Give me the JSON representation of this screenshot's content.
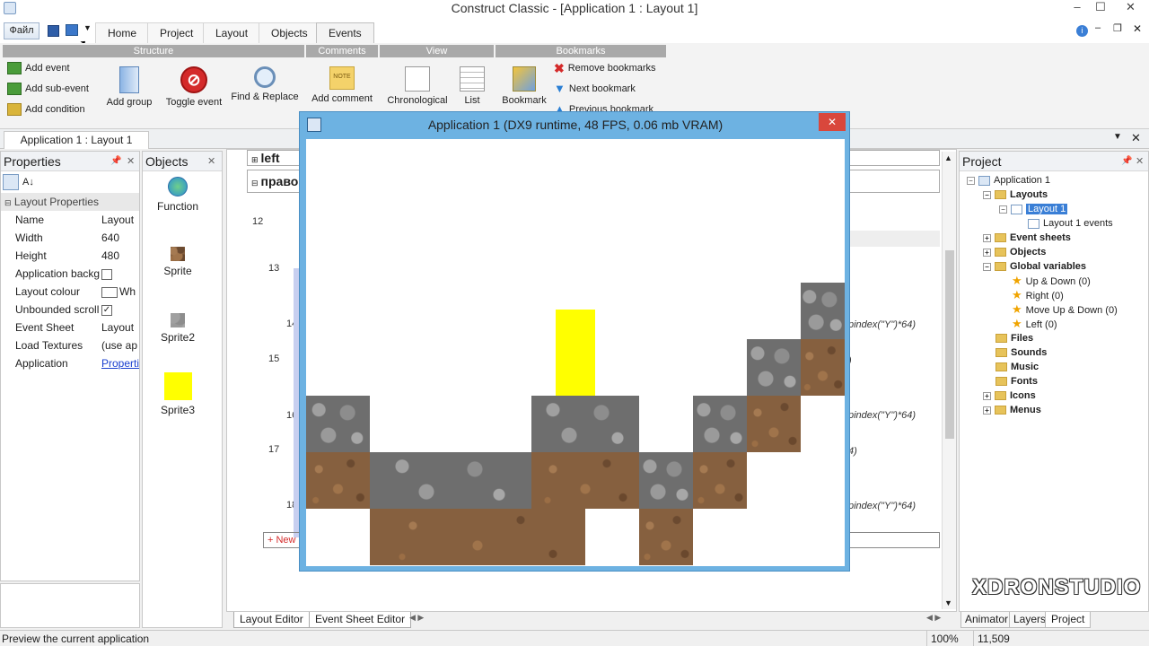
{
  "window": {
    "title": "Construct Classic - [Application 1 : Layout 1]",
    "minimize": "–",
    "maximize": "☐",
    "close": "✕"
  },
  "menu_tabs": {
    "file": "Файл",
    "tabs": [
      "Home",
      "Project",
      "Layout",
      "Objects",
      "Events"
    ],
    "active": "Events"
  },
  "ribbon": {
    "groups": {
      "structure": "Structure",
      "comments": "Comments",
      "view": "View",
      "bookmarks": "Bookmarks"
    },
    "add_event": "Add event",
    "add_sub_event": "Add sub-event",
    "add_condition": "Add condition",
    "add_group": "Add group",
    "toggle_event": "Toggle event",
    "find_replace": "Find & Replace",
    "add_comment": "Add comment",
    "note_text": "NOTE",
    "chronological": "Chronological",
    "list": "List",
    "bookmark": "Bookmark",
    "remove_bookmarks": "Remove bookmarks",
    "next_bookmark": "Next bookmark",
    "previous_bookmark": "Previous bookmark"
  },
  "doc_tab": "Application 1 : Layout 1",
  "properties": {
    "title": "Properties",
    "section": "Layout Properties",
    "rows": [
      {
        "name": "Name",
        "value": "Layout"
      },
      {
        "name": "Width",
        "value": "640"
      },
      {
        "name": "Height",
        "value": "480"
      },
      {
        "name": "Application backg",
        "value": ""
      },
      {
        "name": "Layout colour",
        "value": "Wh"
      },
      {
        "name": "Unbounded scrolli",
        "value": "✓"
      },
      {
        "name": "Event Sheet",
        "value": "Layout"
      },
      {
        "name": "Load Textures",
        "value": "(use ap"
      },
      {
        "name": "Application",
        "value": "Properti"
      }
    ]
  },
  "objects": {
    "title": "Objects",
    "items": [
      "Function",
      "Sprite",
      "Sprite2",
      "Sprite3"
    ]
  },
  "events": {
    "group_left": "left",
    "group_right": "право",
    "lines": [
      "12",
      "13",
      "14",
      "15",
      "16",
      "17",
      "18"
    ],
    "frag1": "pindex(\"Y\")*64)",
    "frag2": ")",
    "frag3": "pindex(\"Y\")*64)",
    "frag4": "4)",
    "frag5": "pindex(\"Y\")*64)",
    "new_event": "+ New e",
    "bottom_tabs": [
      "Layout Editor",
      "Event Sheet Editor"
    ]
  },
  "preview": {
    "title": "Application 1 (DX9 runtime, 48 FPS, 0.06 mb VRAM)",
    "close": "✕"
  },
  "project": {
    "title": "Project",
    "tree": [
      "Application 1",
      "Layouts",
      "Layout 1",
      "Layout 1 events",
      "Event sheets",
      "Objects",
      "Global variables",
      "Up & Down (0)",
      "Right (0)",
      "Move Up & Down (0)",
      "Left (0)",
      "Files",
      "Sounds",
      "Music",
      "Fonts",
      "Icons",
      "Menus"
    ],
    "bottom_tabs": [
      "Animator",
      "Layers",
      "Project"
    ]
  },
  "watermark": "XDRONSTUDIO",
  "status": {
    "message": "Preview the current application",
    "zoom": "100%",
    "coords": "11,509"
  }
}
